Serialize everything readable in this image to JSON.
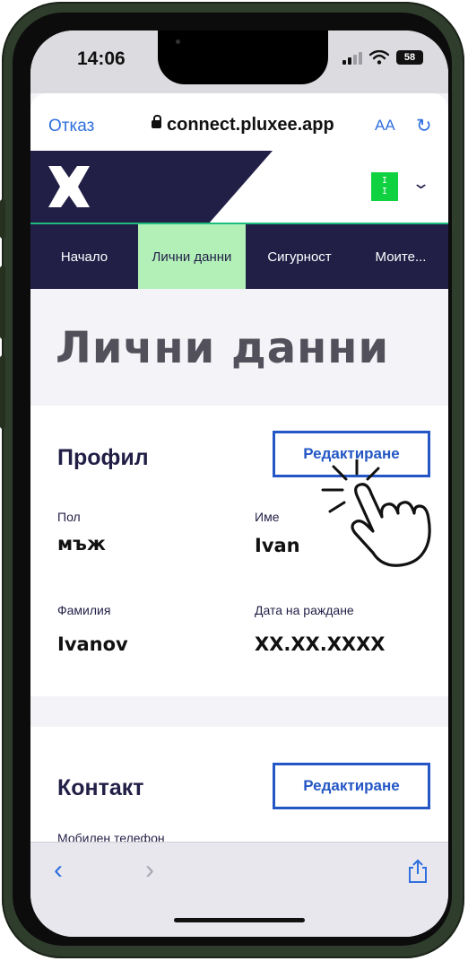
{
  "status_bar": {
    "time": "14:06",
    "battery": "58"
  },
  "browser": {
    "cancel": "Отказ",
    "domain": "connect.pluxee.app",
    "text_size": "AA"
  },
  "header": {
    "avatar_initials": "I\nI"
  },
  "nav": {
    "items": [
      "Начало",
      "Лични данни",
      "Сигурност",
      "Моите..."
    ]
  },
  "page": {
    "title": "Лични данни"
  },
  "profile": {
    "title": "Профил",
    "edit_label": "Редактиране",
    "fields": [
      {
        "label": "Пол",
        "value": "мъж"
      },
      {
        "label": "Име",
        "value": "Ivan"
      },
      {
        "label": "Фамилия",
        "value": "Ivanov"
      },
      {
        "label": "Дата на раждане",
        "value": "XX.XX.XXXX"
      }
    ]
  },
  "contact": {
    "title": "Контакт",
    "edit_label": "Редактиране",
    "field_label": "Мобилен телефон"
  },
  "colors": {
    "brand_dark": "#221f47",
    "accent_green": "#1fbd7d",
    "active_tab": "#b2f0b8",
    "link_blue": "#2457c5"
  }
}
